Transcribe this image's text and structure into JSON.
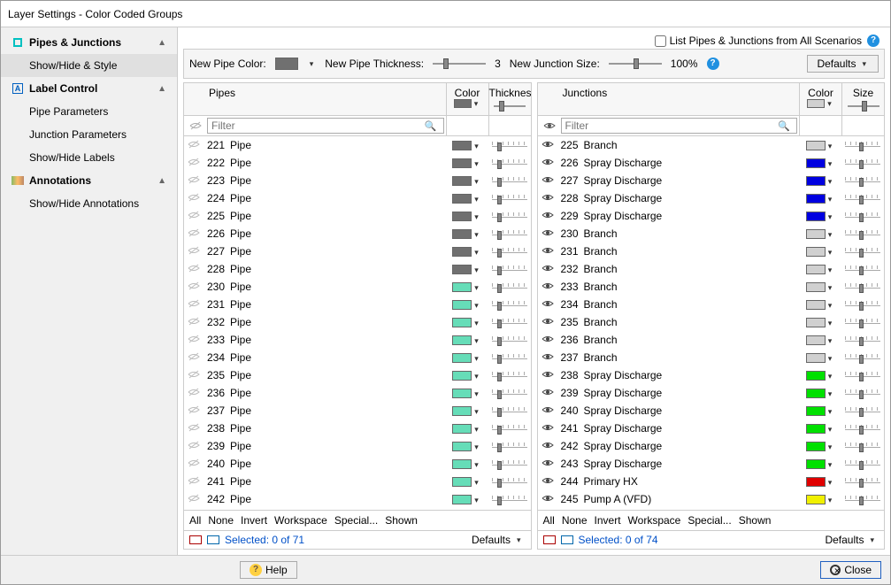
{
  "title": "Layer Settings - Color Coded Groups",
  "sidebar": {
    "pipes": {
      "label": "Pipes & Junctions",
      "item_showstyle": "Show/Hide & Style"
    },
    "label": {
      "label": "Label Control",
      "item_pipeparams": "Pipe Parameters",
      "item_junctionparams": "Junction Parameters",
      "item_showhidelabels": "Show/Hide Labels"
    },
    "ann": {
      "label": "Annotations",
      "item_showhideann": "Show/Hide Annotations"
    }
  },
  "toprow": {
    "checkbox": "List Pipes & Junctions from All Scenarios"
  },
  "toolbar": {
    "newpipecolor": "New Pipe Color:",
    "newpipecolor_val": "#707070",
    "newpipethickness": "New Pipe Thickness:",
    "thickness_val": "3",
    "newjunctionsize": "New Junction Size:",
    "size_val": "100%",
    "defaults": "Defaults"
  },
  "grid_pipes": {
    "header": "Pipes",
    "col_color": "Color",
    "col_thick": "Thickness",
    "filter_ph": "Filter",
    "rows": [
      {
        "vis": false,
        "id": "221",
        "name": "Pipe",
        "color": "#707070"
      },
      {
        "vis": false,
        "id": "222",
        "name": "Pipe",
        "color": "#707070"
      },
      {
        "vis": false,
        "id": "223",
        "name": "Pipe",
        "color": "#707070"
      },
      {
        "vis": false,
        "id": "224",
        "name": "Pipe",
        "color": "#707070"
      },
      {
        "vis": false,
        "id": "225",
        "name": "Pipe",
        "color": "#707070"
      },
      {
        "vis": false,
        "id": "226",
        "name": "Pipe",
        "color": "#707070"
      },
      {
        "vis": false,
        "id": "227",
        "name": "Pipe",
        "color": "#707070"
      },
      {
        "vis": false,
        "id": "228",
        "name": "Pipe",
        "color": "#707070"
      },
      {
        "vis": false,
        "id": "230",
        "name": "Pipe",
        "color": "#66ddb8"
      },
      {
        "vis": false,
        "id": "231",
        "name": "Pipe",
        "color": "#66ddb8"
      },
      {
        "vis": false,
        "id": "232",
        "name": "Pipe",
        "color": "#66ddb8"
      },
      {
        "vis": false,
        "id": "233",
        "name": "Pipe",
        "color": "#66ddb8"
      },
      {
        "vis": false,
        "id": "234",
        "name": "Pipe",
        "color": "#66ddb8"
      },
      {
        "vis": false,
        "id": "235",
        "name": "Pipe",
        "color": "#66ddb8"
      },
      {
        "vis": false,
        "id": "236",
        "name": "Pipe",
        "color": "#66ddb8"
      },
      {
        "vis": false,
        "id": "237",
        "name": "Pipe",
        "color": "#66ddb8"
      },
      {
        "vis": false,
        "id": "238",
        "name": "Pipe",
        "color": "#66ddb8"
      },
      {
        "vis": false,
        "id": "239",
        "name": "Pipe",
        "color": "#66ddb8"
      },
      {
        "vis": false,
        "id": "240",
        "name": "Pipe",
        "color": "#66ddb8"
      },
      {
        "vis": false,
        "id": "241",
        "name": "Pipe",
        "color": "#66ddb8"
      },
      {
        "vis": false,
        "id": "242",
        "name": "Pipe",
        "color": "#66ddb8"
      }
    ],
    "sel": {
      "all": "All",
      "none": "None",
      "invert": "Invert",
      "workspace": "Workspace",
      "special": "Special...",
      "shown": "Shown"
    },
    "status": "Selected: 0 of 71",
    "defaults": "Defaults"
  },
  "grid_junctions": {
    "header": "Junctions",
    "col_color": "Color",
    "col_size": "Size",
    "filter_ph": "Filter",
    "rows": [
      {
        "vis": true,
        "id": "225",
        "name": "Branch",
        "color": "#d0d0d0"
      },
      {
        "vis": true,
        "id": "226",
        "name": "Spray Discharge",
        "color": "#0000e0"
      },
      {
        "vis": true,
        "id": "227",
        "name": "Spray Discharge",
        "color": "#0000e0"
      },
      {
        "vis": true,
        "id": "228",
        "name": "Spray Discharge",
        "color": "#0000e0"
      },
      {
        "vis": true,
        "id": "229",
        "name": "Spray Discharge",
        "color": "#0000e0"
      },
      {
        "vis": true,
        "id": "230",
        "name": "Branch",
        "color": "#d0d0d0"
      },
      {
        "vis": true,
        "id": "231",
        "name": "Branch",
        "color": "#d0d0d0"
      },
      {
        "vis": true,
        "id": "232",
        "name": "Branch",
        "color": "#d0d0d0"
      },
      {
        "vis": true,
        "id": "233",
        "name": "Branch",
        "color": "#d0d0d0"
      },
      {
        "vis": true,
        "id": "234",
        "name": "Branch",
        "color": "#d0d0d0"
      },
      {
        "vis": true,
        "id": "235",
        "name": "Branch",
        "color": "#d0d0d0"
      },
      {
        "vis": true,
        "id": "236",
        "name": "Branch",
        "color": "#d0d0d0"
      },
      {
        "vis": true,
        "id": "237",
        "name": "Branch",
        "color": "#d0d0d0"
      },
      {
        "vis": true,
        "id": "238",
        "name": "Spray Discharge",
        "color": "#00e000"
      },
      {
        "vis": true,
        "id": "239",
        "name": "Spray Discharge",
        "color": "#00e000"
      },
      {
        "vis": true,
        "id": "240",
        "name": "Spray Discharge",
        "color": "#00e000"
      },
      {
        "vis": true,
        "id": "241",
        "name": "Spray Discharge",
        "color": "#00e000"
      },
      {
        "vis": true,
        "id": "242",
        "name": "Spray Discharge",
        "color": "#00e000"
      },
      {
        "vis": true,
        "id": "243",
        "name": "Spray Discharge",
        "color": "#00e000"
      },
      {
        "vis": true,
        "id": "244",
        "name": "Primary HX",
        "color": "#e00000"
      },
      {
        "vis": true,
        "id": "245",
        "name": "Pump A (VFD)",
        "color": "#f0f000"
      }
    ],
    "sel": {
      "all": "All",
      "none": "None",
      "invert": "Invert",
      "workspace": "Workspace",
      "special": "Special...",
      "shown": "Shown"
    },
    "status": "Selected: 0 of 74",
    "defaults": "Defaults"
  },
  "footer": {
    "help": "Help",
    "close": "Close"
  }
}
